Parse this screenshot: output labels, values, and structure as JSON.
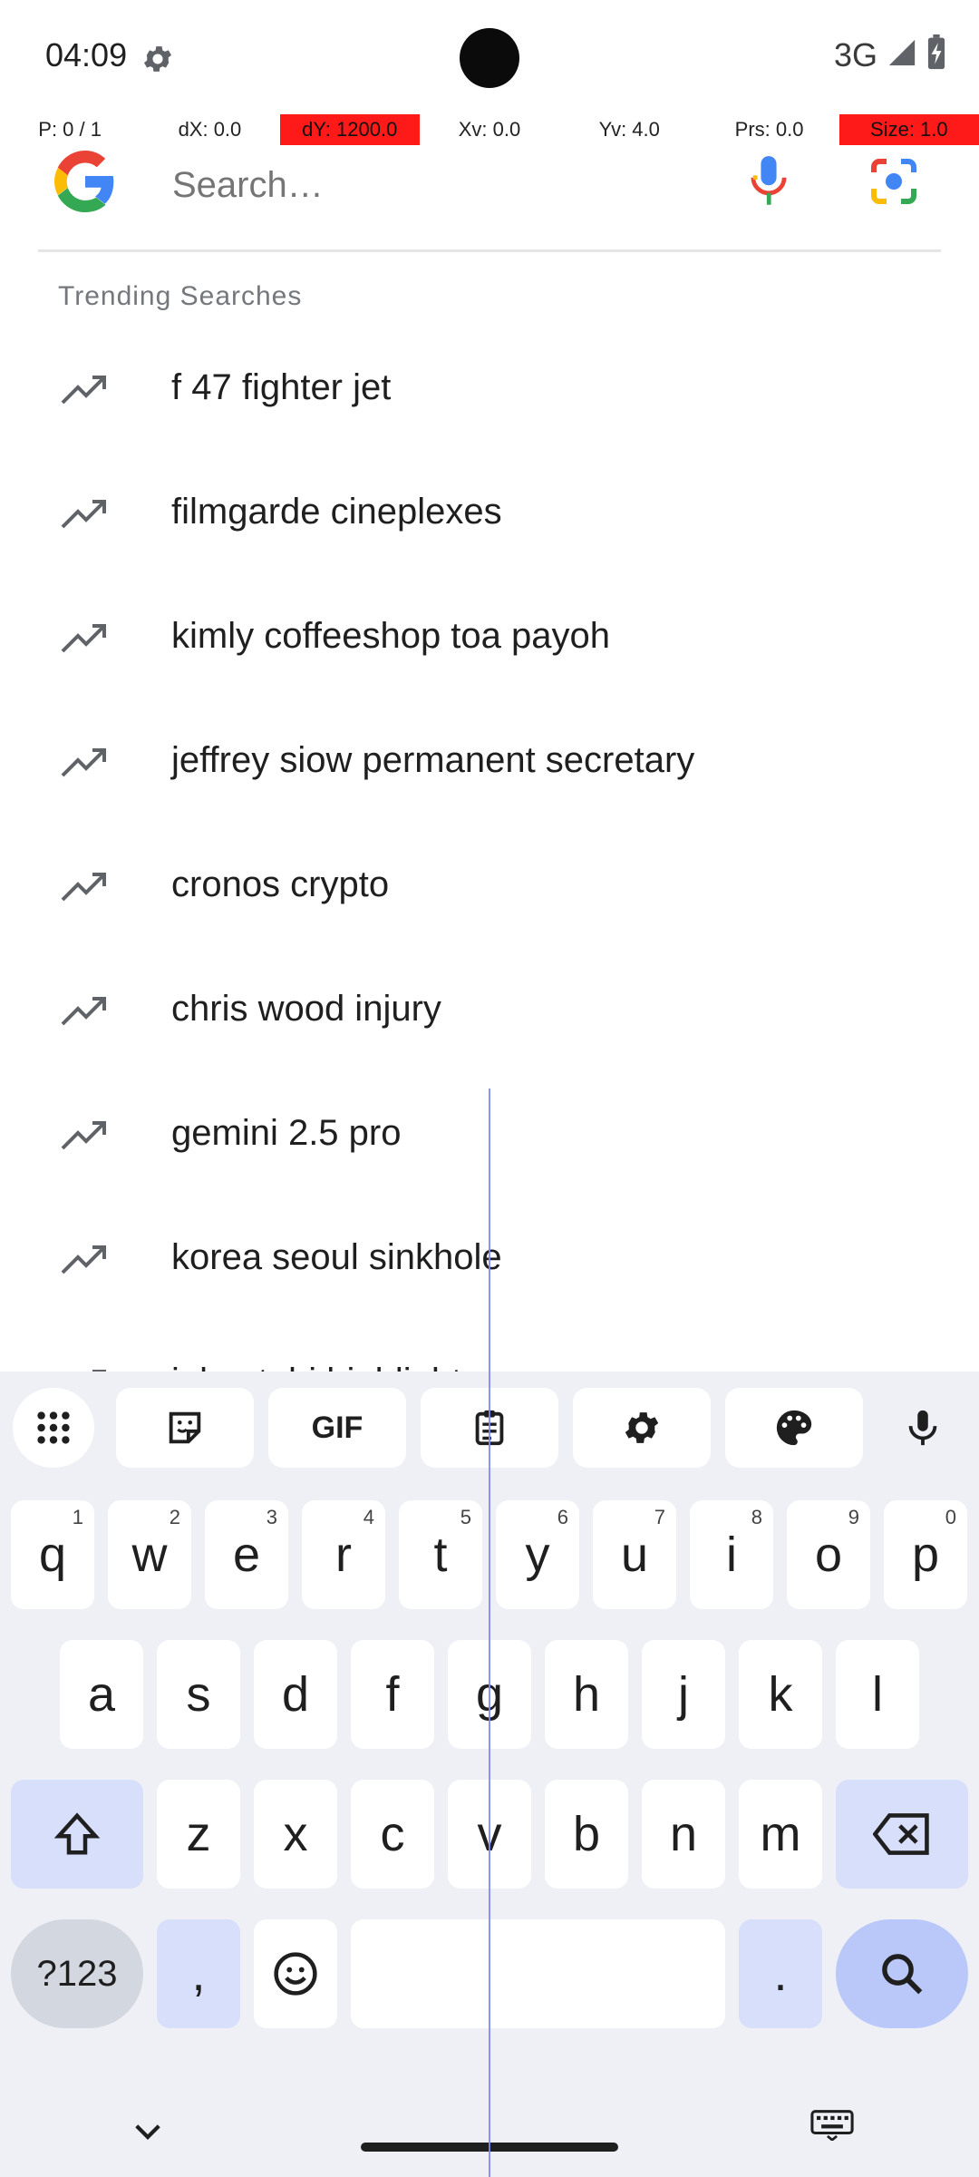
{
  "status": {
    "time": "04:09",
    "network": "3G"
  },
  "overlay": [
    "P: 0 / 1",
    "dX: 0.0",
    "dY: 1200.0",
    "Xv: 0.0",
    "Yv: 4.0",
    "Prs: 0.0",
    "Size: 1.0"
  ],
  "search": {
    "placeholder": "Search…"
  },
  "trending": {
    "title": "Trending Searches",
    "items": [
      "f 47 fighter jet",
      "filmgarde cineplexes",
      "kimly coffeeshop toa payoh",
      "jeffrey siow permanent secretary",
      "cronos crypto",
      "chris wood injury",
      "gemini 2.5 pro",
      "korea seoul sinkhole",
      "jalan tahi highlight"
    ]
  },
  "keyboard": {
    "toolbar": [
      "apps-grid",
      "sticker",
      "GIF",
      "clipboard",
      "settings",
      "theme",
      "mic"
    ],
    "gif_label": "GIF",
    "row1": [
      [
        "q",
        "1"
      ],
      [
        "w",
        "2"
      ],
      [
        "e",
        "3"
      ],
      [
        "r",
        "4"
      ],
      [
        "t",
        "5"
      ],
      [
        "y",
        "6"
      ],
      [
        "u",
        "7"
      ],
      [
        "i",
        "8"
      ],
      [
        "o",
        "9"
      ],
      [
        "p",
        "0"
      ]
    ],
    "row2": [
      "a",
      "s",
      "d",
      "f",
      "g",
      "h",
      "j",
      "k",
      "l"
    ],
    "row3": [
      "z",
      "x",
      "c",
      "v",
      "b",
      "n",
      "m"
    ],
    "symbols_label": "?123",
    "comma": ",",
    "period": "."
  },
  "colors": {
    "overlay_highlight": "#ff1a1a",
    "keyboard_bg": "#eef0f6",
    "modifier_key": "#d8dffa"
  }
}
